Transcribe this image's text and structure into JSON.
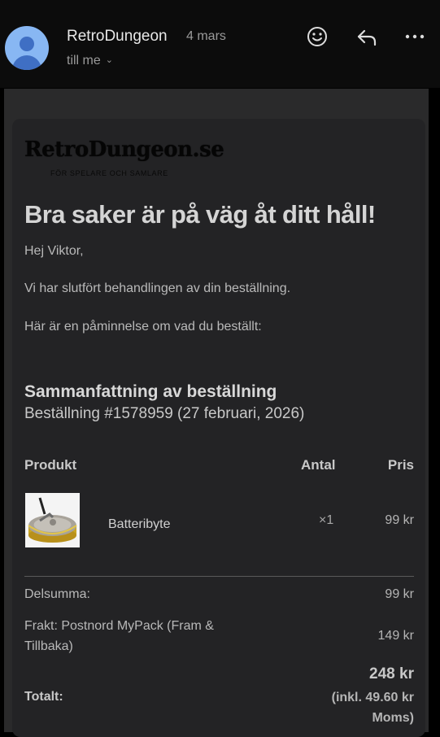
{
  "header": {
    "sender": "RetroDungeon",
    "date": "4 mars",
    "recipient": "till me"
  },
  "email": {
    "logo": {
      "main": "RetroDungeon.se",
      "tagline": "FÖR SPELARE OCH SAMLARE"
    },
    "heading": "Bra saker är på väg åt ditt håll!",
    "greeting": "Hej Viktor,",
    "paragraph1": "Vi har slutfört behandlingen av din beställning.",
    "paragraph2": "Här är en påminnelse om vad du beställt:",
    "summary_title": "Sammanfattning av beställning",
    "order_line": "Beställning #1578959 (27 februari, 2026)",
    "table": {
      "headers": {
        "product": "Produkt",
        "quantity": "Antal",
        "price": "Pris"
      },
      "items": [
        {
          "name": "Batteribyte",
          "quantity": "×1",
          "price": "99 kr"
        }
      ]
    },
    "totals": {
      "subtotal_label": "Delsumma:",
      "subtotal_value": "99 kr",
      "shipping_label": "Frakt: Postnord MyPack (Fram & Tillbaka)",
      "shipping_value": "149 kr",
      "total_label": "Totalt:",
      "total_value": "248 kr",
      "total_note": "(inkl. 49.60 kr Moms)"
    }
  }
}
